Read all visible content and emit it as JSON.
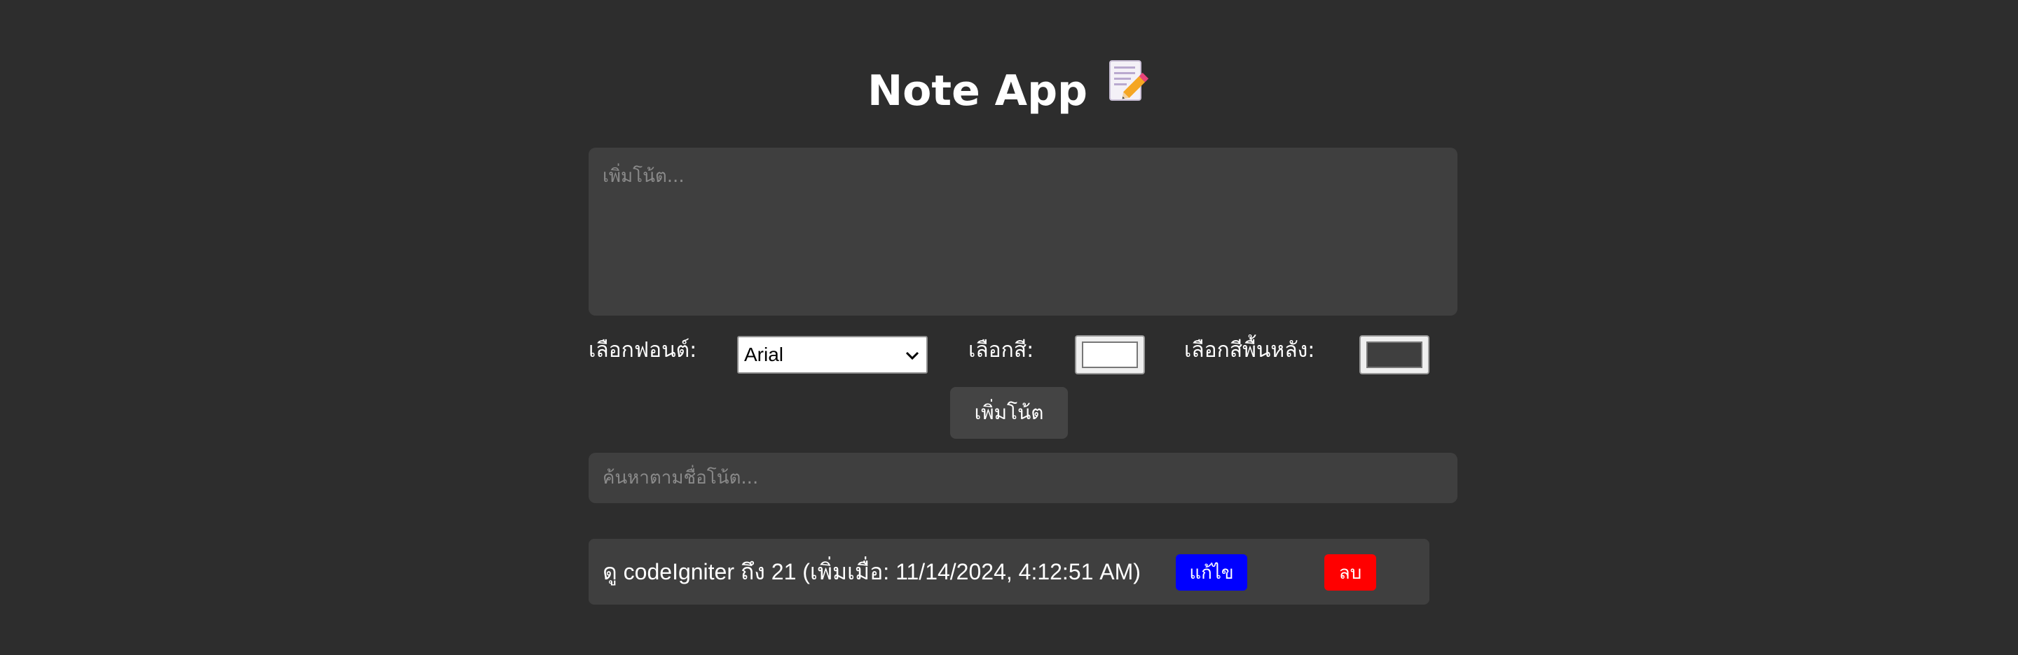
{
  "app": {
    "title": "Note App",
    "title_icon": "memo-icon"
  },
  "note_input": {
    "placeholder": "เพิ่มโน้ต...",
    "value": ""
  },
  "controls": {
    "font_label": "เลือกฟอนต์:",
    "font_selected": "Arial",
    "color_label": "เลือกสี:",
    "text_color": "#ffffff",
    "bg_color_label": "เลือกสีพื้นหลัง:",
    "bg_color": "#3f3f3f",
    "add_button_label": "เพิ่มโน้ต"
  },
  "search": {
    "placeholder": "ค้นหาตามชื่อโน้ต...",
    "value": ""
  },
  "notes": [
    {
      "text": "ดู codeIgniter ถึง 21 (เพิ่มเมื่อ: 11/14/2024, 4:12:51 AM)",
      "edit_label": "แก้ไข",
      "delete_label": "ลบ"
    }
  ],
  "colors": {
    "page_bg": "#2d2d2d",
    "panel_bg": "#3f3f3f",
    "edit_button": "#0000ff",
    "delete_button": "#ff0000"
  }
}
